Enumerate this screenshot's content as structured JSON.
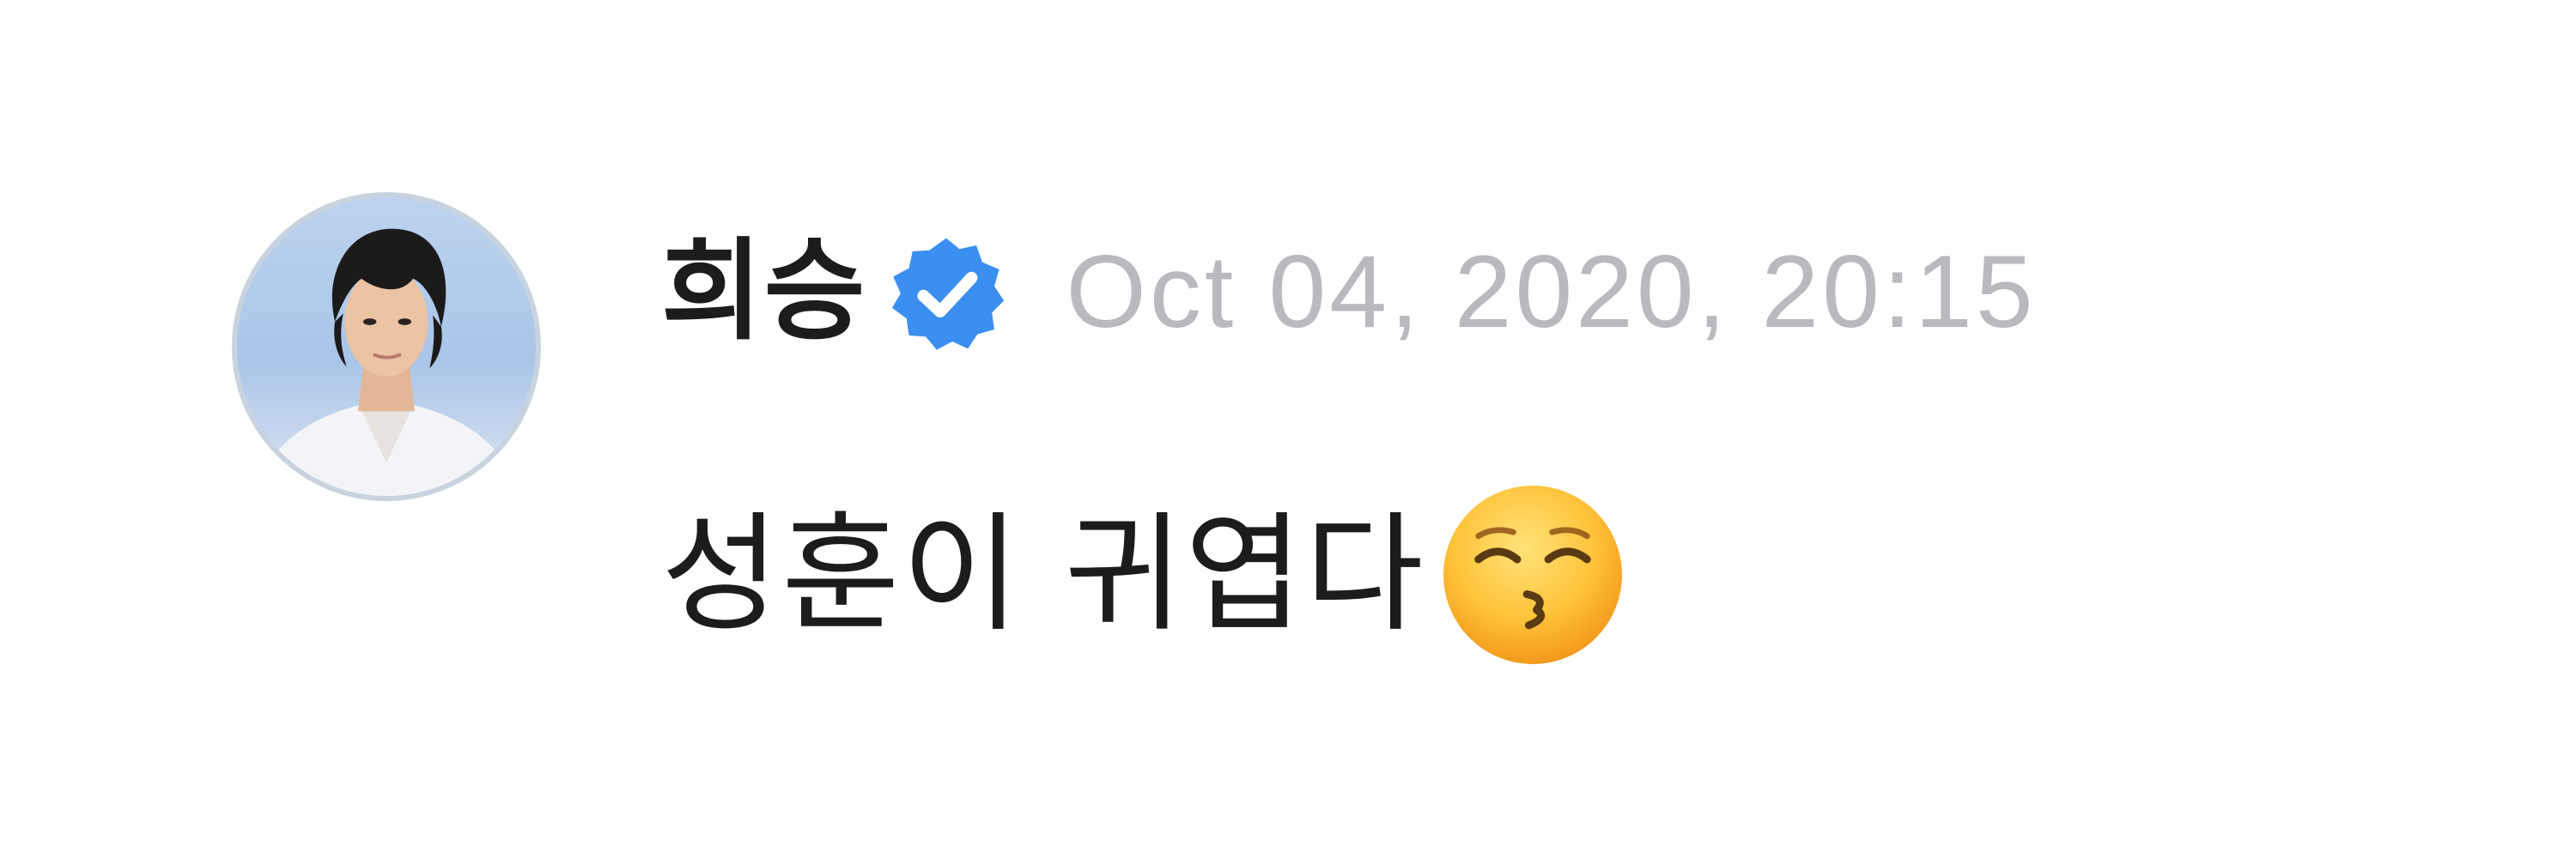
{
  "post": {
    "author": {
      "name": "희승",
      "verified": true,
      "avatar": "profile-photo"
    },
    "timestamp": "Oct 04, 2020, 20:15",
    "message": {
      "text": "성훈이 귀엽다",
      "emoji": "kissing-face-with-closed-eyes"
    }
  },
  "colors": {
    "verified_badge": "#3b8ff0",
    "name_text": "#1c1c1e",
    "timestamp_text": "#b9b9be",
    "message_text": "#1c1c1e"
  }
}
